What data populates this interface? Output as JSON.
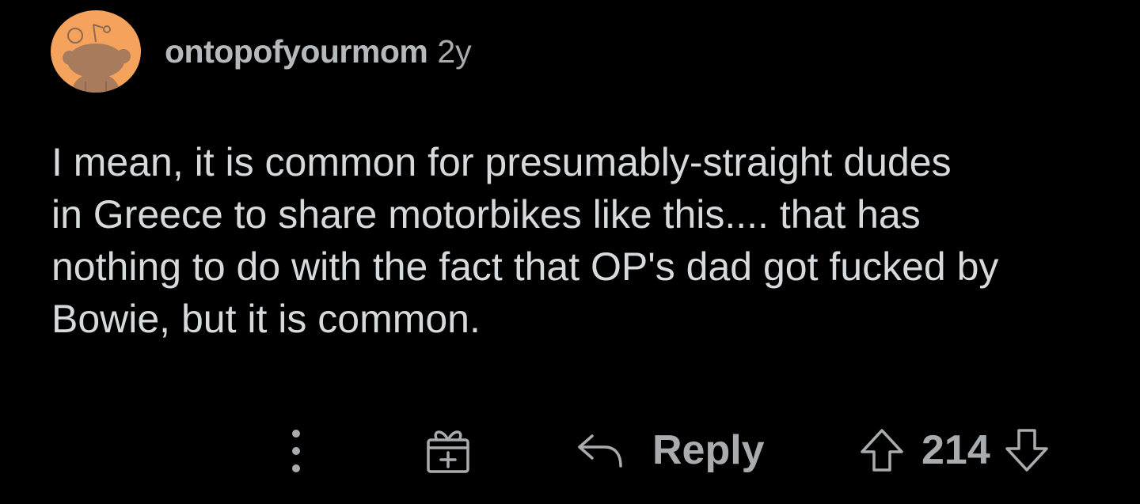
{
  "comment": {
    "author": "ontopofyourmom",
    "age": "2y",
    "avatar_icon": "snoo-avatar-icon",
    "avatar_color": "#f5a35c",
    "text": "I mean, it is common for presumably-straight dudes\nin Greece to share motorbikes like this.... that has\nnothing to do with the fact that OP's dad got fucked by\nBowie, but it is common."
  },
  "actions": {
    "more_icon": "more-options-icon",
    "award_icon": "award-gift-icon",
    "reply_icon": "reply-arrow-icon",
    "reply_label": "Reply",
    "upvote_icon": "upvote-arrow-icon",
    "score": "214",
    "downvote_icon": "downvote-arrow-icon"
  },
  "colors": {
    "background": "#000000",
    "text": "#d7dadc",
    "muted": "#a8acaf"
  }
}
